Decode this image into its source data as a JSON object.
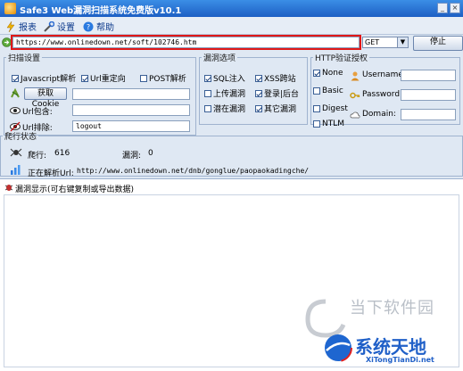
{
  "window": {
    "title": "Safe3 Web漏洞扫描系统免费版v10.1",
    "min": "_",
    "close": "×"
  },
  "menu": [
    {
      "label": "报表"
    },
    {
      "label": "设置"
    },
    {
      "label": "帮助"
    }
  ],
  "url_bar": {
    "value": "https://www.onlinedown.net/soft/102746.htm",
    "method": "GET",
    "stop_label": "停止"
  },
  "scan_settings": {
    "legend": "扫描设置",
    "options": [
      {
        "label": "Javascript解析",
        "checked": true
      },
      {
        "label": "Url重定向",
        "checked": true
      },
      {
        "label": "POST解析",
        "checked": false
      }
    ],
    "cookie_button": "获取Cookie",
    "cookie_value": "",
    "url_include_label": "Url包含:",
    "url_include_value": "",
    "url_exclude_label": "Url排除:",
    "url_exclude_value": "logout"
  },
  "vuln_options": {
    "legend": "漏洞选项",
    "items": [
      {
        "label": "SQL注入",
        "checked": true
      },
      {
        "label": "XSS跨站",
        "checked": true
      },
      {
        "label": "上传漏洞",
        "checked": false
      },
      {
        "label": "登录|后台",
        "checked": true
      },
      {
        "label": "潜在漏洞",
        "checked": false
      },
      {
        "label": "其它漏洞",
        "checked": true
      }
    ]
  },
  "http_auth": {
    "legend": "HTTP验证授权",
    "types": [
      {
        "label": "None",
        "checked": true
      },
      {
        "label": "Basic",
        "checked": false
      },
      {
        "label": "Digest",
        "checked": false
      },
      {
        "label": "NTLM",
        "checked": false
      }
    ],
    "username_label": "Username:",
    "password_label": "Password:",
    "domain_label": "Domain:"
  },
  "crawl_status": {
    "legend": "爬行状态",
    "crawled_label": "爬行:",
    "crawled_count": "616",
    "vuln_label": "漏洞:",
    "vuln_count": "0",
    "parsing_label": "正在解析Url:",
    "parsing_url": "http://www.onlinedown.net/dnb/gonglue/paopaokadingche/"
  },
  "vuln_display": {
    "title": "漏洞显示(可右键复制或导出数据)"
  },
  "watermarks": {
    "line1": "当下软件园",
    "line2": "系统天地",
    "line3": "XiTongTianDi.net"
  },
  "colors": {
    "title_bar": "#1d5fc4",
    "highlight": "#e01818",
    "watermark_blue": "#2060c8"
  }
}
